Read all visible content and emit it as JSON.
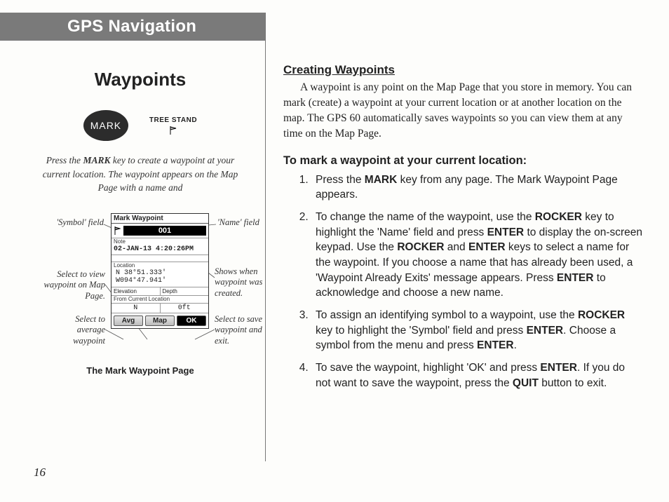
{
  "header": {
    "title": "GPS Navigation"
  },
  "page_number": "16",
  "left": {
    "title": "Waypoints",
    "mark_label": "MARK",
    "tree_stand": "TREE STAND",
    "caption_a_pre": "Press the ",
    "caption_a_bold": "MARK",
    "caption_a_post": " key to create a waypoint at your current location. The waypoint appears on the Map Page with a name and",
    "device": {
      "title": "Mark Waypoint",
      "name": "001",
      "note_label": "Note",
      "date": "02-JAN-13 4:20:26PM",
      "location_label": "Location",
      "lat": "N  38°51.333'",
      "lon": "W094°47.941'",
      "elev_label": "Elevation",
      "depth_label": "Depth",
      "from_label": "From Current Location",
      "bearing": "N",
      "dist": "0ft",
      "btn_avg": "Avg",
      "btn_map": "Map",
      "btn_ok": "OK"
    },
    "anno": {
      "symbol": "'Symbol' field",
      "name": "'Name' field",
      "view": "Select to view waypoint on Map Page.",
      "shows": "Shows when waypoint was created.",
      "avg": "Select to average waypoint",
      "save": "Select to save waypoint and exit."
    },
    "diagram_caption": "The Mark Waypoint Page"
  },
  "right": {
    "heading": "Creating Waypoints",
    "para1": "A waypoint is any point on the Map Page that you store in memory. You can mark (create) a waypoint at your current location or at another location on the map. The GPS 60 automatically saves waypoints so you can view them at any time on the Map Page.",
    "subheading": "To mark a waypoint at your current location:",
    "steps": {
      "s1a": "Press the ",
      "s1b": "MARK",
      "s1c": " key from any page. The Mark Waypoint Page appears.",
      "s2a": "To change the name of the waypoint, use the ",
      "s2b": "ROCKER",
      "s2c": " key to highlight the 'Name' field and press ",
      "s2d": "ENTER",
      "s2e": " to display the on-screen keypad.  Use the ",
      "s2f": "ROCKER",
      "s2g": " and ",
      "s2h": "ENTER",
      "s2i": " keys to select a name for the waypoint. If you choose a name that has already been used, a 'Waypoint Already Exits' message appears. Press ",
      "s2j": "ENTER",
      "s2k": " to acknowledge and choose a new name.",
      "s3a": "To assign an identifying symbol to a waypoint, use the ",
      "s3b": "ROCKER",
      "s3c": " key to highlight the 'Symbol' field and press ",
      "s3d": "ENTER",
      "s3e": ". Choose a symbol from the menu and press ",
      "s3f": "ENTER",
      "s3g": ".",
      "s4a": "To save the waypoint, highlight 'OK' and press ",
      "s4b": "ENTER",
      "s4c": ". If you do not want to save the waypoint, press the ",
      "s4d": "QUIT",
      "s4e": " button to exit."
    }
  }
}
